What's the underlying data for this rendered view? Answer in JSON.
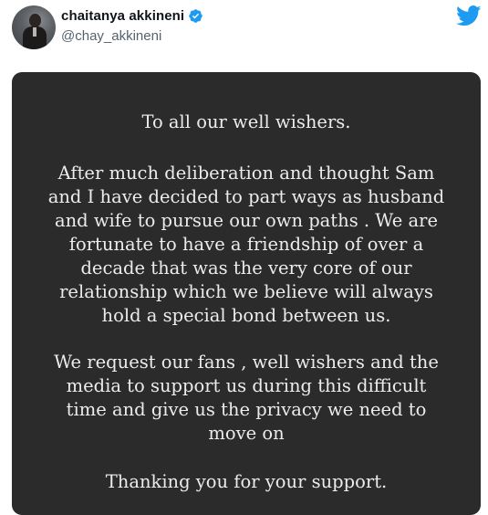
{
  "tweet": {
    "author": {
      "display_name": "chaitanya akkineni",
      "handle": "@chay_akkineni",
      "verified": true,
      "avatar_icon": "profile-photo"
    },
    "brand_icon": "twitter-bird-icon",
    "brand_color": "#1d9bf0",
    "media": {
      "background_color": "#2b2b2b",
      "text_color": "#ececec",
      "greeting": "To all our well wishers.",
      "paragraph_1": "After much deliberation and thought Sam\nand I have decided to part ways as husband\nand wife to pursue our own paths . We are\nfortunate to have a friendship of over a\ndecade that was the very core of our\nrelationship which we believe will always\nhold a special bond between us.",
      "paragraph_2": "We request our fans , well wishers and the\nmedia to support us during this difficult\ntime and give us the privacy we need to\nmove on",
      "closing": "Thanking you for your support."
    }
  }
}
